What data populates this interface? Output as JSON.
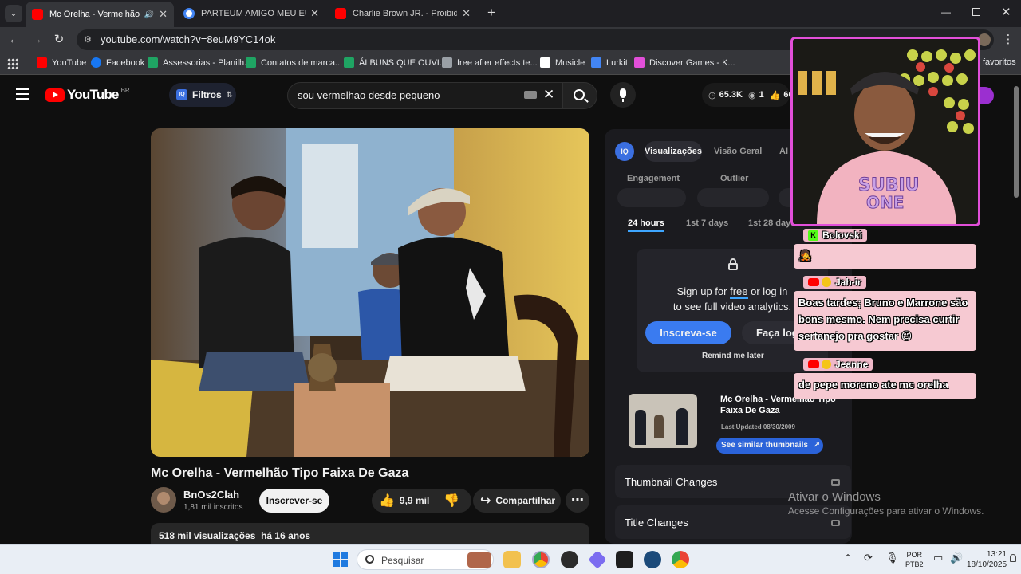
{
  "browser": {
    "tabs": [
      {
        "title": "Mc Orelha - Vermelhão Tip",
        "active": true
      },
      {
        "title": "PARTEUM AMIGO MEU EU PAG",
        "active": false
      },
      {
        "title": "Charlie Brown JR. - Proibida Pra",
        "active": false
      }
    ],
    "new_tab": "+",
    "url": "youtube.com/watch?v=8euM9YC14ok",
    "bookmarks": [
      {
        "label": "YouTube",
        "color": "#ff0000"
      },
      {
        "label": "Facebook",
        "color": "#1877f2"
      },
      {
        "label": "Assessorias - Planilh...",
        "color": "#1fa463"
      },
      {
        "label": "Contatos de marca...",
        "color": "#1fa463"
      },
      {
        "label": "ÁLBUNS QUE OUVI...",
        "color": "#1fa463"
      },
      {
        "label": "free after effects te...",
        "color": "#9aa0a6"
      },
      {
        "label": "Musicle",
        "color": "#ffffff"
      },
      {
        "label": "Lurkit",
        "color": "#4285f4"
      },
      {
        "label": "Discover Games - K...",
        "color": "#e24fd9"
      }
    ],
    "favorites_label": "favoritos"
  },
  "youtube": {
    "logo": "YouTube",
    "logo_region": "BR",
    "filters_label": "Filtros",
    "search_value": "sou vermelhao desde pequeno",
    "stats": {
      "views": "65.3K",
      "eyes": "1",
      "likes": "66"
    },
    "video_title": "Mc Orelha - Vermelhão Tipo Faixa De Gaza",
    "channel_name": "BnOs2Clah",
    "channel_subs": "1,81 mil inscritos",
    "subscribe_label": "Inscrever-se",
    "likes_label": "9,9 mil",
    "share_label": "Compartilhar",
    "description_meta": "518 mil visualizações  há 16 anos"
  },
  "panel": {
    "tabs": [
      "Visualizações",
      "Visão Geral",
      "AI"
    ],
    "metrics": [
      "Engagement",
      "Outlier"
    ],
    "periods": [
      "24 hours",
      "1st 7 days",
      "1st 28 days"
    ],
    "signup_line1_pre": "Sign up for ",
    "signup_free": "free",
    "signup_line1_post": " or log in",
    "signup_line2": "to see full video analytics.",
    "signup_button": "Inscreva-se",
    "login_button": "Faça login",
    "remind_label": "Remind me later",
    "related": {
      "title": "Mc Orelha - Vermelhão Tipo Faixa De Gaza",
      "updated": "Last Updated 08/30/2009",
      "similar_button": "See similar thumbnails"
    },
    "locked_rows": [
      "Thumbnail Changes",
      "Title Changes"
    ]
  },
  "chat": [
    {
      "name": "Bolovski",
      "platform": "kick",
      "message": "🧑‍🎤"
    },
    {
      "name": "Jah-ir",
      "platform": "youtube",
      "message": "Boas tardes; Bruno e Marrone são bons mesmo. Nem precisa curtir sertanejo pra gostar 😄"
    },
    {
      "name": "Jeanne",
      "platform": "youtube",
      "message": "de pepe moreno ate mc orelha"
    }
  ],
  "watermark": {
    "line1": "Ativar o Windows",
    "line2": "Acesse Configurações para ativar o Windows."
  },
  "taskbar": {
    "search_placeholder": "Pesquisar",
    "lang_line1": "POR",
    "lang_line2": "PTB2",
    "time": "13:21",
    "date": "18/10/2025"
  }
}
